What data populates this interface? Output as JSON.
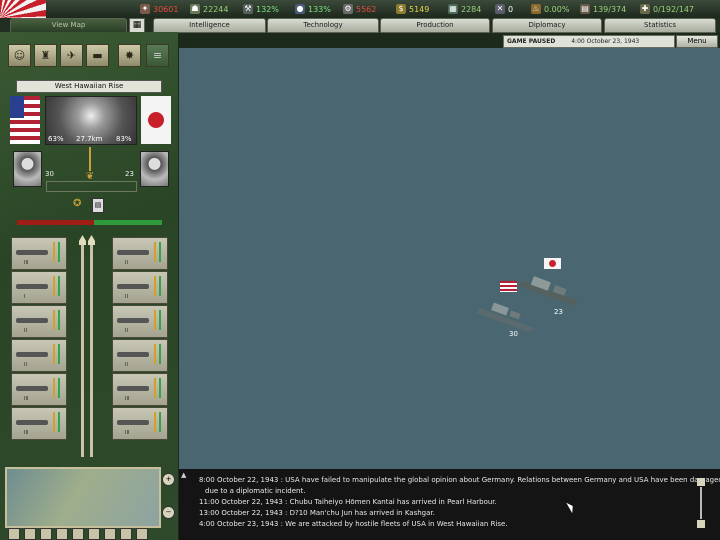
{
  "resources": [
    {
      "icon": "shield-icon",
      "value": "30601",
      "color": "#e64c3c"
    },
    {
      "icon": "soldier-icon",
      "value": "22244",
      "color": "#9ad27a"
    },
    {
      "icon": "wrench-icon",
      "value": "132%",
      "color": "#7ee07e"
    },
    {
      "icon": "oil-drop-icon",
      "value": "133%",
      "color": "#7ee07e"
    },
    {
      "icon": "gear-icon",
      "value": "5562",
      "color": "#e64c3c"
    },
    {
      "icon": "money-icon",
      "value": "5149",
      "color": "#e6d34c"
    },
    {
      "icon": "factory-icon",
      "value": "2284",
      "color": "#9ad27a"
    },
    {
      "icon": "crossed-swords-icon",
      "value": "0",
      "color": "#ffffff"
    },
    {
      "icon": "flame-icon",
      "value": "0.00%",
      "color": "#9ad27a"
    },
    {
      "icon": "supply-icon",
      "value": "139/374",
      "color": "#9ad27a"
    },
    {
      "icon": "rifle-icon",
      "value": "0/192/147",
      "color": "#9ad27a"
    }
  ],
  "tabs": [
    "View Map",
    "Intelligence",
    "Technology",
    "Production",
    "Diplomacy",
    "Statistics"
  ],
  "status": {
    "paused": "GAME PAUSED",
    "datetime": "4:00 October 23, 1943"
  },
  "menu_label": "Menu",
  "battle": {
    "location": "West Hawaiian Rise",
    "left_pct": "63%",
    "distance": "27.7km",
    "right_pct": "83%",
    "left_count": "30",
    "right_count": "23"
  },
  "units": {
    "left": [
      {
        "rank": "III"
      },
      {
        "rank": "I"
      },
      {
        "rank": "II"
      },
      {
        "rank": "II"
      },
      {
        "rank": "III"
      },
      {
        "rank": "III"
      }
    ],
    "right": [
      {
        "rank": "II"
      },
      {
        "rank": "II"
      },
      {
        "rank": "II"
      },
      {
        "rank": "II"
      },
      {
        "rank": "III"
      },
      {
        "rank": "III"
      }
    ]
  },
  "map": {
    "us_fleet": "30",
    "jp_fleet": "23"
  },
  "log": [
    "8:00 October 22, 1943 : USA have failed to manipulate the global opinion about Germany. Relations between Germany and USA have been damaged",
    "due to a diplomatic incident.",
    "11:00 October 22, 1943 : Chubu Taiheiyo Hōmen Kantai has arrived in Pearl Harbour.",
    "13:00 October 22, 1943 : D?10 Man'chu Jun has arrived in Kashgar.",
    "4:00 October 23, 1943 : We are attacked by hostile fleets of USA in West Hawaiian Rise."
  ]
}
